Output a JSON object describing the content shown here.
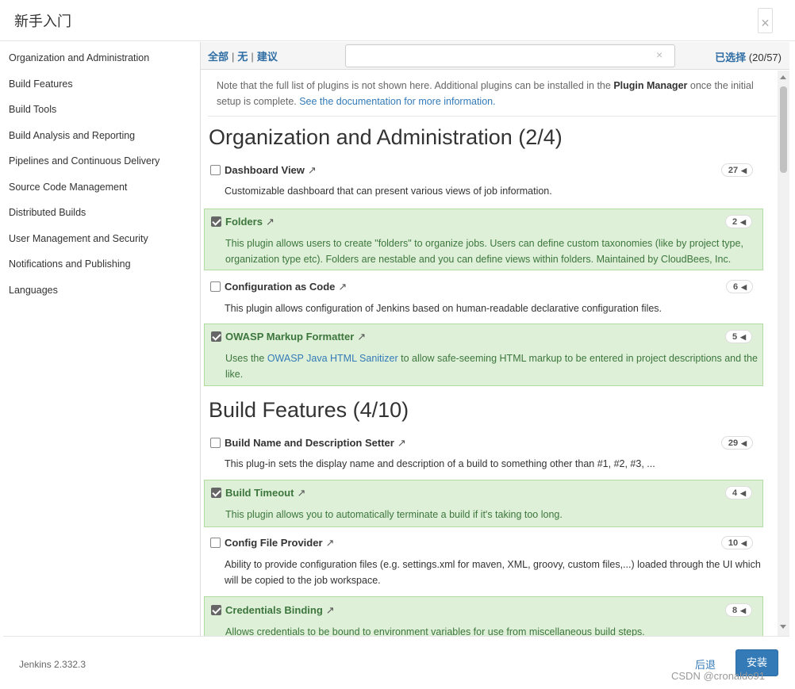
{
  "dialog": {
    "title": "新手入门",
    "close": "×"
  },
  "sidebar": {
    "items": [
      {
        "label": "Organization and Administration"
      },
      {
        "label": "Build Features"
      },
      {
        "label": "Build Tools"
      },
      {
        "label": "Build Analysis and Reporting"
      },
      {
        "label": "Pipelines and Continuous Delivery"
      },
      {
        "label": "Source Code Management"
      },
      {
        "label": "Distributed Builds"
      },
      {
        "label": "User Management and Security"
      },
      {
        "label": "Notifications and Publishing"
      },
      {
        "label": "Languages"
      }
    ]
  },
  "toolbar": {
    "all": "全部",
    "sep": "|",
    "none": "无",
    "suggested": "建议",
    "search_value": "",
    "clear": "×",
    "selected_label": "已选择",
    "selected_count": "(20/57)"
  },
  "note": {
    "text1": "Note that the full list of plugins is not shown here. Additional plugins can be installed in the ",
    "bold": "Plugin Manager",
    "text2": " once the initial setup is complete. ",
    "link": "See the documentation for more information."
  },
  "groups": [
    {
      "title": "Organization and Administration (2/4)",
      "plugins": [
        {
          "name": "Dashboard View",
          "ext": "↗",
          "count": "27",
          "selected": false,
          "desc": "Customizable dashboard that can present various views of job information."
        },
        {
          "name": "Folders",
          "ext": "↗",
          "count": "2",
          "selected": true,
          "desc": "This plugin allows users to create \"folders\" to organize jobs. Users can define custom taxonomies (like by project type, organization type etc). Folders are nestable and you can define views within folders. Maintained by CloudBees, Inc."
        },
        {
          "name": "Configuration as Code",
          "ext": "↗",
          "count": "6",
          "selected": false,
          "desc": "This plugin allows configuration of Jenkins based on human-readable declarative configuration files."
        },
        {
          "name": "OWASP Markup Formatter",
          "ext": "↗",
          "count": "5",
          "selected": true,
          "desc_pre": "Uses the ",
          "desc_link": "OWASP Java HTML Sanitizer",
          "desc_post": " to allow safe-seeming HTML markup to be entered in project descriptions and the like."
        }
      ]
    },
    {
      "title": "Build Features (4/10)",
      "plugins": [
        {
          "name": "Build Name and Description Setter",
          "ext": "↗",
          "count": "29",
          "selected": false,
          "desc": "This plug-in sets the display name and description of a build to something other than #1, #2, #3, ..."
        },
        {
          "name": "Build Timeout",
          "ext": "↗",
          "count": "4",
          "selected": true,
          "desc": "This plugin allows you to automatically terminate a build if it's taking too long."
        },
        {
          "name": "Config File Provider",
          "ext": "↗",
          "count": "10",
          "selected": false,
          "desc": "Ability to provide configuration files (e.g. settings.xml for maven, XML, groovy, custom files,...) loaded through the UI which will be copied to the job workspace."
        },
        {
          "name": "Credentials Binding",
          "ext": "↗",
          "count": "8",
          "selected": true,
          "desc": "Allows credentials to be bound to environment variables for use from miscellaneous build steps."
        }
      ]
    }
  ],
  "footer": {
    "version": "Jenkins 2.332.3",
    "back": "后退",
    "install": "安装"
  },
  "watermark": "CSDN @cronaldo91",
  "colors": {
    "accent": "#337ab7",
    "selected_bg": "#dff0d8",
    "selected_text": "#3c763d"
  }
}
